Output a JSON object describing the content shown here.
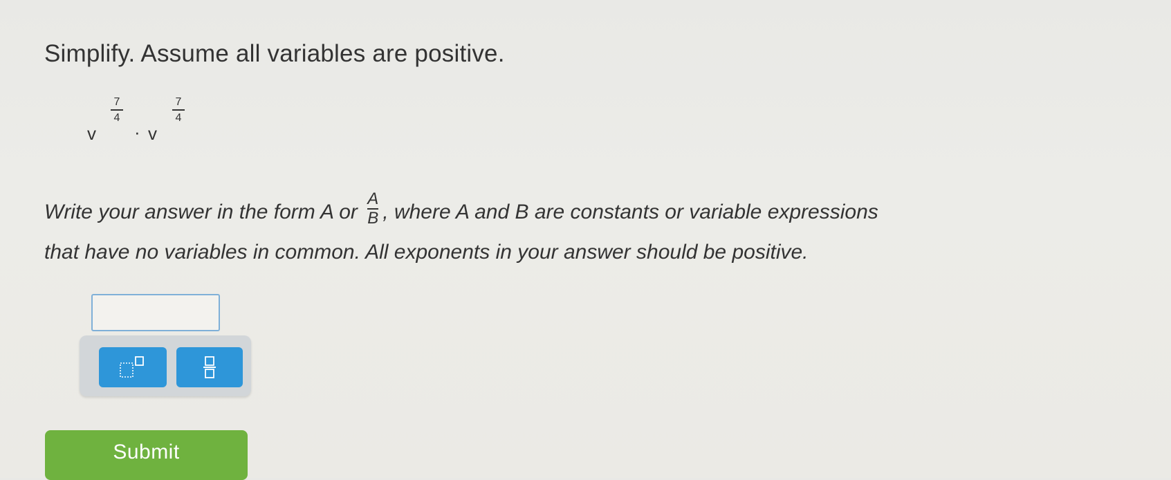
{
  "question": {
    "instruction": "Simplify. Assume all variables are positive.",
    "expression": {
      "base1": "v",
      "exp1_num": "7",
      "exp1_den": "4",
      "operator": "·",
      "base2": "v",
      "exp2_num": "7",
      "exp2_den": "4"
    },
    "directions": {
      "part1": "Write your answer in the form A or",
      "frac_num": "A",
      "frac_den": "B",
      "part2": ", where A and B are constants or variable expressions",
      "line2": "that have no variables in common. All exponents in your answer should be positive."
    }
  },
  "answer": {
    "value": "",
    "placeholder": ""
  },
  "toolbar": {
    "buttons": [
      {
        "icon": "superscript-icon"
      },
      {
        "icon": "fraction-icon"
      }
    ]
  },
  "submit": {
    "label": "Submit"
  },
  "colors": {
    "tool_button": "#2e96d9",
    "submit_button": "#6fb23f",
    "input_border": "#7fb0d8",
    "toolbar_bg": "#d2d6d9"
  }
}
